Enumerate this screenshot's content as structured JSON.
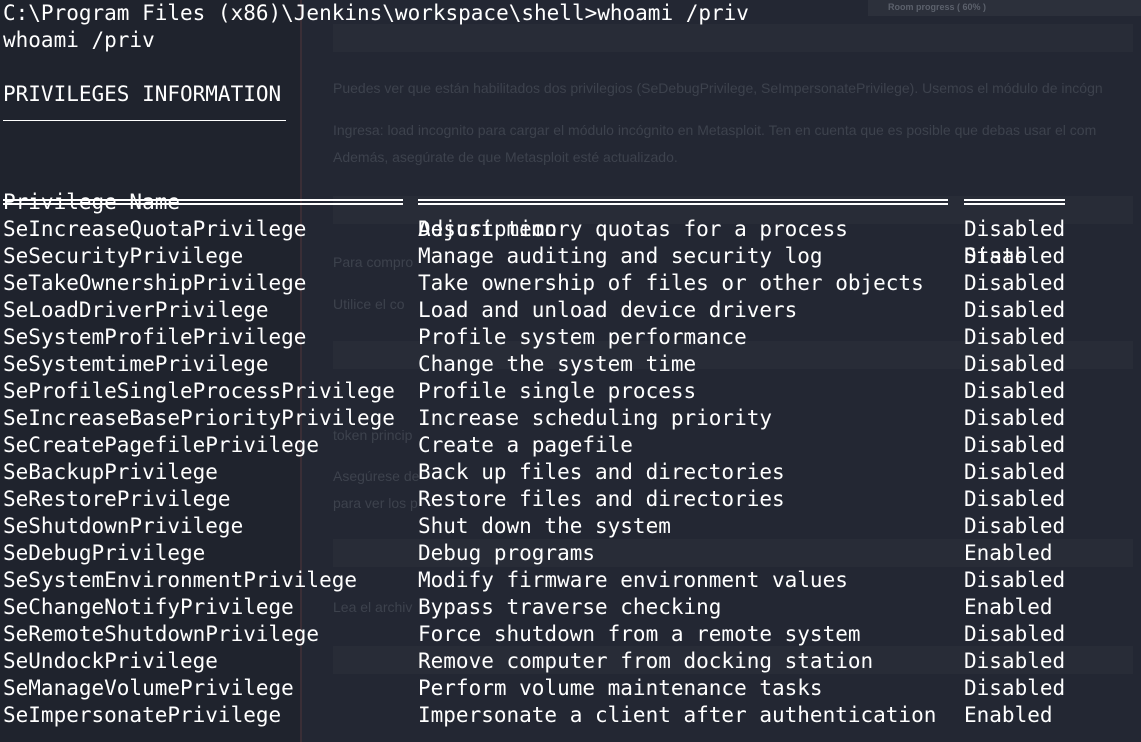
{
  "background_page": {
    "progress": "Room progress ( 60% )",
    "lines": [
      "Puedes ver que están habilitados dos privilegios (SeDebugPrivilege, SeImpersonatePrivilege). Usemos el módulo de incógn",
      "Ingresa: load incognito para cargar el módulo incógnito en Metasploit. Ten en cuenta que es posible que debas usar el com",
      "Además, asegúrate de que Metasploit esté actualizado.",
      "Para compro",
      "Utilice el co",
      "token princip",
      "Asegúrese de",
      "para ver los p",
      "Lea el archiv"
    ]
  },
  "terminal": {
    "prompt_line": "C:\\Program Files (x86)\\Jenkins\\workspace\\shell>whoami /priv",
    "echo_line": "whoami /priv",
    "section_title": "PRIVILEGES INFORMATION",
    "headers": {
      "name": "Privilege Name",
      "description": "Description",
      "state": "State"
    },
    "rows": [
      {
        "name": "SeIncreaseQuotaPrivilege",
        "description": "Adjust memory quotas for a process",
        "state": "Disabled"
      },
      {
        "name": "SeSecurityPrivilege",
        "description": "Manage auditing and security log",
        "state": "Disabled"
      },
      {
        "name": "SeTakeOwnershipPrivilege",
        "description": "Take ownership of files or other objects",
        "state": "Disabled"
      },
      {
        "name": "SeLoadDriverPrivilege",
        "description": "Load and unload device drivers",
        "state": "Disabled"
      },
      {
        "name": "SeSystemProfilePrivilege",
        "description": "Profile system performance",
        "state": "Disabled"
      },
      {
        "name": "SeSystemtimePrivilege",
        "description": "Change the system time",
        "state": "Disabled"
      },
      {
        "name": "SeProfileSingleProcessPrivilege",
        "description": "Profile single process",
        "state": "Disabled"
      },
      {
        "name": "SeIncreaseBasePriorityPrivilege",
        "description": "Increase scheduling priority",
        "state": "Disabled"
      },
      {
        "name": "SeCreatePagefilePrivilege",
        "description": "Create a pagefile",
        "state": "Disabled"
      },
      {
        "name": "SeBackupPrivilege",
        "description": "Back up files and directories",
        "state": "Disabled"
      },
      {
        "name": "SeRestorePrivilege",
        "description": "Restore files and directories",
        "state": "Disabled"
      },
      {
        "name": "SeShutdownPrivilege",
        "description": "Shut down the system",
        "state": "Disabled"
      },
      {
        "name": "SeDebugPrivilege",
        "description": "Debug programs",
        "state": "Enabled"
      },
      {
        "name": "SeSystemEnvironmentPrivilege",
        "description": "Modify firmware environment values",
        "state": "Disabled"
      },
      {
        "name": "SeChangeNotifyPrivilege",
        "description": "Bypass traverse checking",
        "state": "Enabled"
      },
      {
        "name": "SeRemoteShutdownPrivilege",
        "description": "Force shutdown from a remote system",
        "state": "Disabled"
      },
      {
        "name": "SeUndockPrivilege",
        "description": "Remove computer from docking station",
        "state": "Disabled"
      },
      {
        "name": "SeManageVolumePrivilege",
        "description": "Perform volume maintenance tasks",
        "state": "Disabled"
      },
      {
        "name": "SeImpersonatePrivilege",
        "description": "Impersonate a client after authentication",
        "state": "Enabled"
      }
    ]
  }
}
